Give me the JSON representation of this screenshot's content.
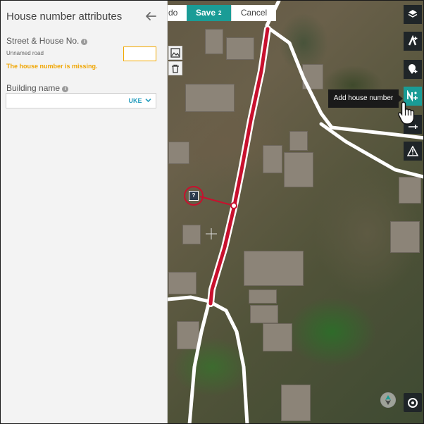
{
  "panel": {
    "title": "House number attributes",
    "street_label": "Street & House No.",
    "road_name": "Unnamed road",
    "house_number_value": "",
    "missing_message": "The house number is missing.",
    "building_name_label": "Building name",
    "building_name_value": "",
    "language_code": "UKE"
  },
  "toolbar": {
    "undo_label": "do",
    "save_label": "Save",
    "save_count": "2",
    "cancel_label": "Cancel"
  },
  "map": {
    "marker_label": "?",
    "tooltip": "Add house number"
  },
  "right_toolbar": {
    "items": [
      {
        "icon": "layers-icon"
      },
      {
        "icon": "add-road-icon"
      },
      {
        "icon": "add-place-icon"
      },
      {
        "icon": "add-house-number-icon",
        "active": true
      },
      {
        "icon": "add-address-icon"
      },
      {
        "icon": "warning-icon"
      }
    ]
  },
  "colors": {
    "accent": "#1a9c96",
    "warning": "#f0a500",
    "road_selected": "#c8102e",
    "toolbar_dark": "#1f2528",
    "link": "#2a9fbf"
  }
}
